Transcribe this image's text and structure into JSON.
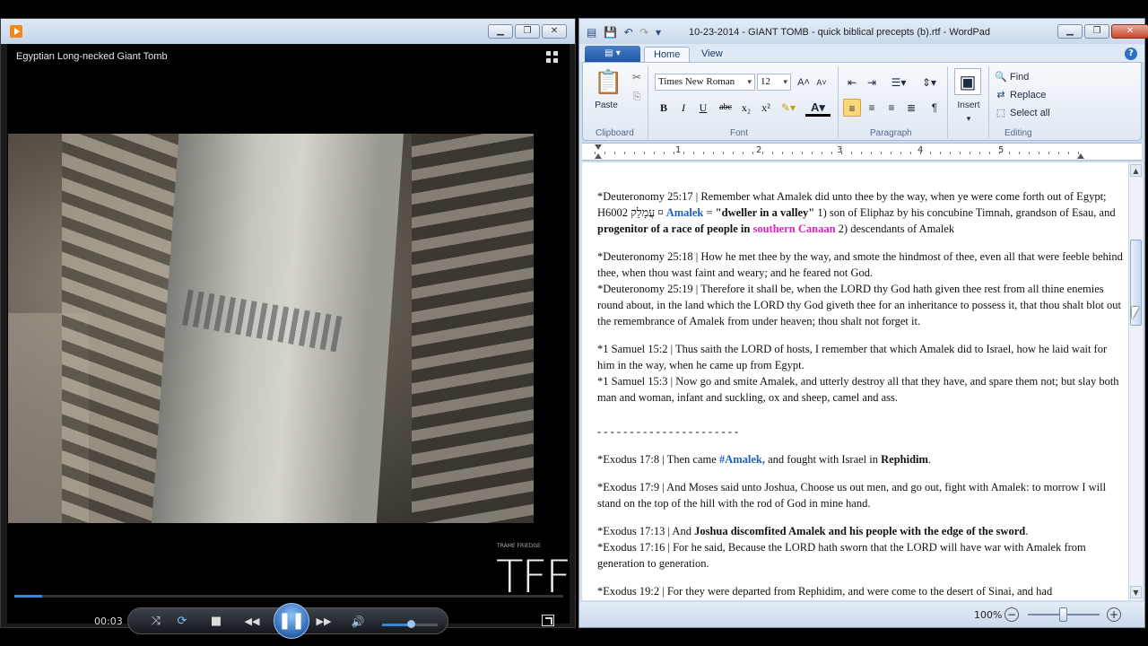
{
  "wmp": {
    "video_title": "Egyptian Long-necked Giant Tomb",
    "watermark_text": "TFF",
    "watermark_small": "TRAME FRIEDGE",
    "time": "00:03",
    "progress_fraction": 0.05,
    "volume_fraction": 0.55,
    "controls": {
      "shuffle": "⤨",
      "repeat": "⟳",
      "stop": "■",
      "previous": "◀◀",
      "play_pause": "❚❚",
      "next": "▶▶",
      "volume": "🔊"
    }
  },
  "wordpad": {
    "title": "10-23-2014 - GIANT TOMB - quick biblical precepts (b).rtf - WordPad",
    "tabs": [
      "Home",
      "View"
    ],
    "help": "?",
    "ribbon": {
      "clipboard": {
        "paste": "Paste",
        "label": "Clipboard"
      },
      "font": {
        "family": "Times New Roman",
        "size": "12",
        "label": "Font",
        "buttons": {
          "bold": "B",
          "italic": "I",
          "underline": "U",
          "strike": "abc",
          "subscript": "x₂",
          "superscript": "x²",
          "grow": "A˄",
          "shrink": "A˅"
        }
      },
      "paragraph": {
        "label": "Paragraph"
      },
      "insert": {
        "label": "Insert"
      },
      "editing": {
        "find": "Find",
        "replace": "Replace",
        "select_all": "Select all",
        "label": "Editing"
      }
    },
    "ruler_numbers": [
      "1",
      "2",
      "3",
      "4",
      "5"
    ],
    "document": {
      "p1_ref": "*Deuteronomy 25:17 | Remember what Amalek did unto thee by the way, when ye were come forth out of Egypt;",
      "p1_h_code": "H6002 עֲמָלֵק ¤ ",
      "p1_amalek": "Amalek",
      "p1_eq": " = ",
      "p1_meaning": "\"dweller in a valley\"",
      "p1_rest1": " 1) son of Eliphaz by his concubine Timnah, grandson of Esau, and ",
      "p1_progenitor": "progenitor of a race of people in",
      "p1_southern": "southern Canaan",
      "p1_rest2": " 2) descendants of Amalek",
      "p2_a": "*Deuteronomy 25:18 | How he met thee by the way, and smote the hindmost of thee, even all that were feeble behind thee, when thou wast faint and weary; and he feared not God.",
      "p2_b": "*Deuteronomy 25:19 | Therefore it shall be, when the LORD thy God hath given thee rest from all thine enemies round about, in the land which the LORD thy God giveth thee for an inheritance to possess it, that thou shalt blot out the remembrance of Amalek from under heaven; thou shalt not forget it.",
      "p3_a": "*1 Samuel 15:2 | Thus saith the LORD of hosts, I remember that which Amalek did to Israel, how he laid wait for him in the way, when he came up from Egypt.",
      "p3_b": "*1 Samuel 15:3 | Now go and smite Amalek, and utterly destroy all that they have, and spare them not; but slay both man and woman, infant and suckling, ox and sheep, camel and ass.",
      "divider": "- - - - - - - - - - - - - - - - - - - - - -",
      "p4_pre": "*Exodus 17:8 | Then came ",
      "p4_tag": "#Amalek,",
      "p4_mid": " and fought with Israel in ",
      "p4_place": "Rephidim",
      "p4_end": ".",
      "p5": "*Exodus 17:9 | And Moses said unto Joshua, Choose us out men, and go out, fight with Amalek: to morrow I will stand on the top of the hill with the rod of God in mine hand.",
      "p6_pre": "*Exodus 17:13 | And ",
      "p6_bold": "Joshua discomfited Amalek and his people with the edge of the sword",
      "p6_end": ".",
      "p6_b": "*Exodus 17:16 | For he said, Because the LORD hath sworn that the LORD will have war with Amalek from generation to generation.",
      "p7_cut": "*Exodus 19:2 | For they were departed from Rephidim, and were come to the desert of Sinai, and had"
    },
    "zoom": "100%"
  }
}
